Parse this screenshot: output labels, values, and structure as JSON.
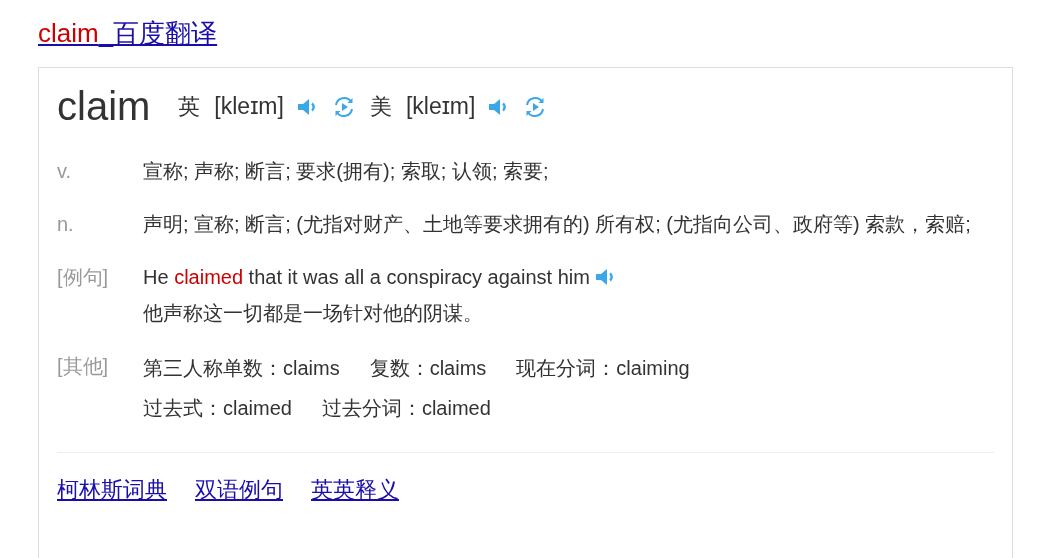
{
  "title": {
    "highlight": "claim",
    "rest": "_百度翻译"
  },
  "headword": "claim",
  "pronunciations": [
    {
      "region": "英",
      "phonetic": "[kleɪm]"
    },
    {
      "region": "美",
      "phonetic": "[kleɪm]"
    }
  ],
  "senses": [
    {
      "kind": "definition",
      "label": "v.",
      "lines": [
        "宣称; 声称; 断言; 要求(拥有); 索取; 认领; 索要;"
      ]
    },
    {
      "kind": "definition",
      "label": "n.",
      "lines": [
        "声明; 宣称; 断言; (尤指对财产、土地等要求拥有的) 所有权; (尤指向公司、政府等) 索款，索赔;"
      ]
    },
    {
      "kind": "example",
      "label": "[例句]",
      "parts": [
        {
          "text": "He ",
          "highlight": false
        },
        {
          "text": "claimed",
          "highlight": true
        },
        {
          "text": " that it was all a conspiracy against him",
          "highlight": false
        }
      ],
      "translation": "他声称这一切都是一场针对他的阴谋。"
    },
    {
      "kind": "forms",
      "label": "[其他]",
      "rows": [
        [
          "第三人称单数：claims",
          "复数：claims",
          "现在分词：claiming"
        ],
        [
          "过去式：claimed",
          "过去分词：claimed"
        ]
      ]
    }
  ],
  "links": [
    "柯林斯词典",
    "双语例句",
    "英英释义"
  ]
}
